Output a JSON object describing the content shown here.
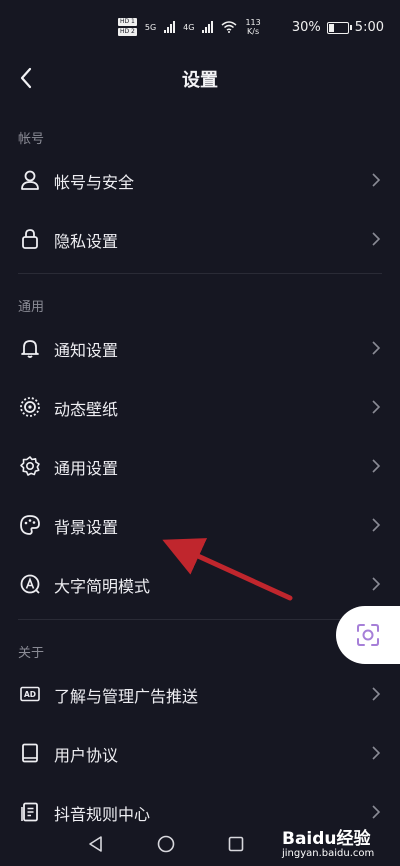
{
  "status_bar": {
    "hd_1": "HD 1",
    "hd_2": "HD 2",
    "net_5g": "5G",
    "net_4g": "4G",
    "speed_value": "113",
    "speed_unit": "K/s",
    "battery_percent": "30%",
    "battery_level": 0.3,
    "time": "5:00"
  },
  "header": {
    "title": "设置"
  },
  "sections": [
    {
      "title": "帐号",
      "items": [
        {
          "label": "帐号与安全",
          "icon": "user-icon"
        },
        {
          "label": "隐私设置",
          "icon": "lock-icon"
        }
      ]
    },
    {
      "title": "通用",
      "items": [
        {
          "label": "通知设置",
          "icon": "bell-icon"
        },
        {
          "label": "动态壁纸",
          "icon": "live-wallpaper-icon"
        },
        {
          "label": "通用设置",
          "icon": "gear-icon"
        },
        {
          "label": "背景设置",
          "icon": "palette-icon"
        },
        {
          "label": "大字简明模式",
          "icon": "large-text-icon"
        }
      ]
    },
    {
      "title": "关于",
      "items": [
        {
          "label": "了解与管理广告推送",
          "icon": "ad-icon"
        },
        {
          "label": "用户协议",
          "icon": "book-icon"
        },
        {
          "label": "抖音规则中心",
          "icon": "document-icon"
        }
      ]
    }
  ],
  "annotation": {
    "color": "#c0262d",
    "target": "背景设置"
  },
  "watermark": {
    "main": "Baidu经验",
    "sub": "jingyan.baidu.com"
  },
  "colors": {
    "background": "#161722",
    "text": "#eeeef2",
    "section": "#8a8b95",
    "divider": "#2a2b36"
  }
}
